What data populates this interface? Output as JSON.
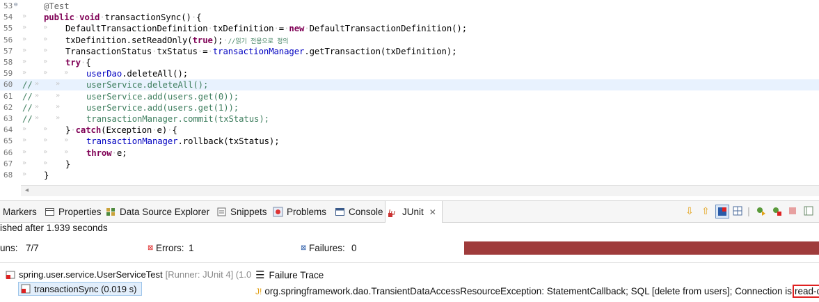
{
  "editor": {
    "lines": [
      {
        "n": "53",
        "code_html": "<span class='ann'>@Test</span>"
      },
      {
        "n": "54",
        "code_html": "<span class='kw'>public</span>·<span class='kw'>void</span>·transactionSync()·{"
      },
      {
        "n": "55",
        "code_html": "DefaultTransactionDefinition·txDefinition·=·<span class='kw'>new</span>·DefaultTransactionDefinition();"
      },
      {
        "n": "56",
        "code_html": "txDefinition.setReadOnly(<span class='kw'>true</span>);·<span class='cmt'>//읽기 전용으로 정의</span>"
      },
      {
        "n": "57",
        "code_html": "TransactionStatus·txStatus·=·<span class='fld'>transactionManager</span>.getTransaction(txDefinition);"
      },
      {
        "n": "58",
        "code_html": "<span class='kw'>try</span>·{"
      },
      {
        "n": "59",
        "code_html": "<span class='fld'>userDao</span>.deleteAll();"
      },
      {
        "n": "60",
        "code_html": "userService.deleteAll();"
      },
      {
        "n": "61",
        "code_html": "userService.add(users.get(0));"
      },
      {
        "n": "62",
        "code_html": "userService.add(users.get(1));"
      },
      {
        "n": "63",
        "code_html": "transactionManager.commit(txStatus);"
      },
      {
        "n": "64",
        "code_html": "}·<span class='kw'>catch</span>(Exception·e)·{"
      },
      {
        "n": "65",
        "code_html": "<span class='fld'>transactionManager</span>.rollback(txStatus);"
      },
      {
        "n": "66",
        "code_html": "<span class='kw'>throw</span>·e;"
      },
      {
        "n": "67",
        "code_html": "}"
      },
      {
        "n": "68",
        "code_html": "}"
      }
    ]
  },
  "tabs": {
    "markers": "Markers",
    "properties": "Properties",
    "dse": "Data Source Explorer",
    "snippets": "Snippets",
    "problems": "Problems",
    "console": "Console",
    "junit": "JUnit"
  },
  "junit": {
    "finished": "ished after 1.939 seconds",
    "runs_label": "uns:",
    "runs_value": "7/7",
    "errors_label": "Errors:",
    "errors_value": "1",
    "failures_label": "Failures:",
    "failures_value": "0",
    "bar_color": "#9f3b3b",
    "tree_root": "spring.user.service.UserServiceTest",
    "tree_root_runner": "[Runner: JUnit 4] (1.0",
    "tree_child": "transactionSync (0.019 s)",
    "failure_trace": "Failure Trace",
    "trace_text": "org.springframework.dao.TransientDataAccessResourceException: StatementCallback; SQL [delete from users]; Connection is",
    "trace_highlight": "read-only."
  }
}
